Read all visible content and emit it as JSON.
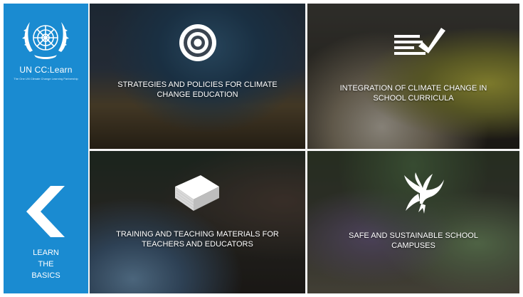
{
  "brand": {
    "name": "UN CC:Learn",
    "tagline": "The One UN Climate Change Learning Partnership"
  },
  "nav": {
    "back_icon": "chevron-left-icon",
    "learn_label_lines": [
      "LEARN",
      "THE",
      "BASICS"
    ]
  },
  "tiles": [
    {
      "icon": "target-icon",
      "title_lines": [
        "STRATEGIES AND POLICIES FOR CLIMATE",
        "CHANGE EDUCATION"
      ]
    },
    {
      "icon": "checklist-icon",
      "title_lines": [
        "INTEGRATION OF CLIMATE CHANGE IN",
        "SCHOOL CURRICULA"
      ]
    },
    {
      "icon": "paper-stack-icon",
      "title_lines": [
        "TRAINING AND TEACHING MATERIALS FOR",
        "TEACHERS AND EDUCATORS"
      ]
    },
    {
      "icon": "dove-icon",
      "title_lines": [
        "SAFE AND SUSTAINABLE SCHOOL",
        "CAMPUSES"
      ]
    }
  ],
  "colors": {
    "sidebar": "#1a8bd1",
    "text": "#ffffff"
  }
}
